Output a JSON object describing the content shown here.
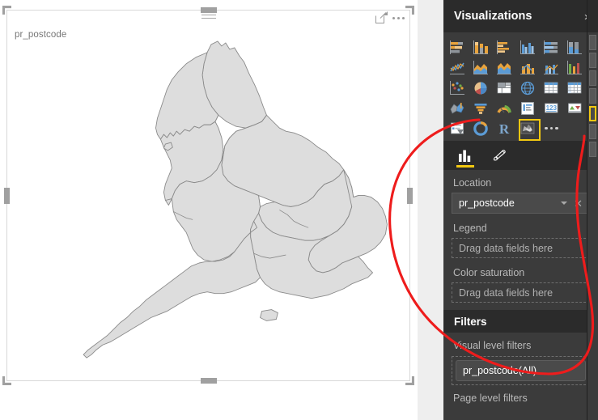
{
  "canvas": {
    "visual_title": "pr_postcode",
    "header_icons": [
      {
        "name": "focus-mode-icon",
        "label": "Focus mode"
      },
      {
        "name": "more-options-icon",
        "label": "More options"
      }
    ],
    "map": {
      "region": "England",
      "fill_color": "#dddddd",
      "stroke_color": "#8a8a8a",
      "background": "#ffffff"
    }
  },
  "visualizations_pane": {
    "title": "Visualizations",
    "expand_chevron": "›",
    "gallery": [
      [
        {
          "name": "stacked-bar-chart-icon",
          "label": "Stacked bar chart"
        },
        {
          "name": "stacked-column-chart-icon",
          "label": "Stacked column chart"
        },
        {
          "name": "clustered-bar-chart-icon",
          "label": "Clustered bar chart"
        },
        {
          "name": "clustered-column-chart-icon",
          "label": "Clustered column chart"
        },
        {
          "name": "hundred-percent-stacked-bar-chart-icon",
          "label": "100% stacked bar chart"
        },
        {
          "name": "hundred-percent-stacked-column-chart-icon",
          "label": "100% stacked column chart"
        }
      ],
      [
        {
          "name": "line-chart-icon",
          "label": "Line chart"
        },
        {
          "name": "area-chart-icon",
          "label": "Area chart"
        },
        {
          "name": "stacked-area-chart-icon",
          "label": "Stacked area chart"
        },
        {
          "name": "line-and-stacked-column-chart-icon",
          "label": "Line and stacked column chart"
        },
        {
          "name": "line-and-clustered-column-chart-icon",
          "label": "Line and clustered column chart"
        },
        {
          "name": "ribbon-chart-icon",
          "label": "Ribbon chart"
        }
      ],
      [
        {
          "name": "scatter-chart-icon",
          "label": "Scatter chart"
        },
        {
          "name": "pie-chart-icon",
          "label": "Pie chart"
        },
        {
          "name": "treemap-icon",
          "label": "Treemap"
        },
        {
          "name": "map-icon",
          "label": "Map"
        },
        {
          "name": "table-icon",
          "label": "Table"
        },
        {
          "name": "matrix-icon",
          "label": "Matrix"
        }
      ],
      [
        {
          "name": "filled-map-icon",
          "label": "Filled map"
        },
        {
          "name": "funnel-icon",
          "label": "Funnel"
        },
        {
          "name": "gauge-icon",
          "label": "Gauge"
        },
        {
          "name": "multi-row-card-icon",
          "label": "Multi-row card"
        },
        {
          "name": "card-icon",
          "label": "Card"
        },
        {
          "name": "kpi-icon",
          "label": "KPI"
        }
      ],
      [
        {
          "name": "slicer-icon",
          "label": "Slicer"
        },
        {
          "name": "arcgis-maps-icon",
          "label": "ArcGIS Maps"
        },
        {
          "name": "r-script-visual-icon",
          "label": "R script visual"
        },
        {
          "name": "shape-map-icon",
          "label": "Shape map",
          "selected": true
        },
        {
          "name": "more-visuals-icon",
          "label": "More visuals"
        }
      ]
    ],
    "field_tabs": [
      {
        "name": "fields-tab",
        "label": "Fields",
        "icon": "bar-chart-icon",
        "active": true
      },
      {
        "name": "format-tab",
        "label": "Format",
        "icon": "paintbrush-icon",
        "active": false
      }
    ],
    "wells": [
      {
        "label": "Location",
        "field": "pr_postcode",
        "filled": true,
        "dropdown_icon": "chevron-down-icon",
        "remove_icon": "close-icon"
      },
      {
        "label": "Legend",
        "placeholder": "Drag data fields here",
        "filled": false
      },
      {
        "label": "Color saturation",
        "placeholder": "Drag data fields here",
        "filled": false
      }
    ]
  },
  "filters_pane": {
    "title": "Filters",
    "sections": [
      {
        "label": "Visual level filters",
        "cards": [
          {
            "text": "pr_postcode(All)"
          }
        ]
      },
      {
        "label": "Page level filters",
        "cards": []
      }
    ]
  },
  "annotation": {
    "type": "hand-drawn-circle",
    "color": "#ee1c1c",
    "stroke_width": 3
  },
  "colors": {
    "accent_yellow": "#f2c811",
    "pane_bg": "#3b3b3b",
    "pane_header_bg": "#2b2b2b",
    "canvas_bg": "#ffffff",
    "gutter_bg": "#eeeeee",
    "map_fill": "#dddddd",
    "map_stroke": "#8a8a8a"
  }
}
